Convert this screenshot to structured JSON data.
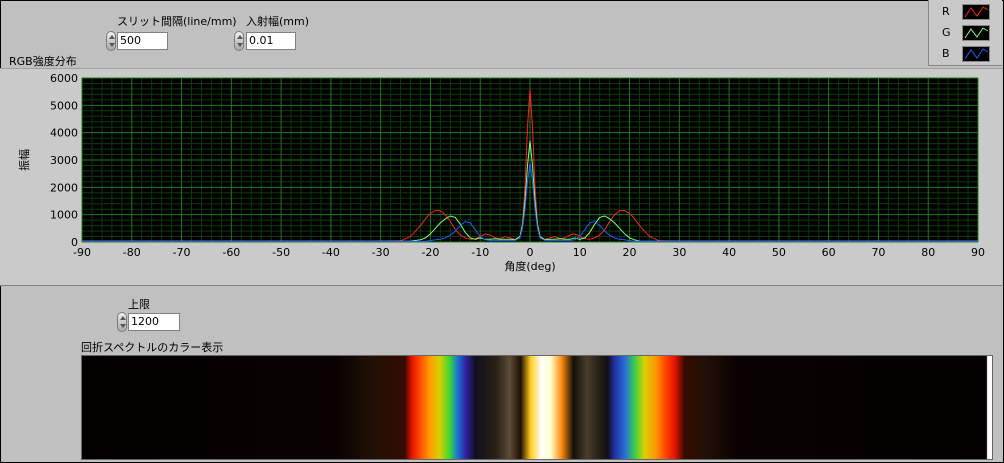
{
  "controls": {
    "slit": {
      "label": "スリット間隔(line/mm)",
      "value": "500"
    },
    "incident": {
      "label": "入射幅(mm)",
      "value": "0.01"
    },
    "upper": {
      "label": "上限",
      "value": "1200"
    }
  },
  "graph": {
    "title": "RGB強度分布"
  },
  "legend": [
    {
      "name": "R",
      "color": "#ff2020"
    },
    {
      "name": "G",
      "color": "#80ff80"
    },
    {
      "name": "B",
      "color": "#2060ff"
    }
  ],
  "spectrum": {
    "title": "回折スペクトルのカラー表示"
  },
  "chart_data": {
    "type": "line",
    "xlabel": "角度(deg)",
    "ylabel": "振幅",
    "xlim": [
      -90,
      90
    ],
    "ylim": [
      0,
      6000
    ],
    "xticks": [
      "-90",
      "-80",
      "-70",
      "-60",
      "-50",
      "-40",
      "-30",
      "-20",
      "-10",
      "0",
      "10",
      "20",
      "30",
      "40",
      "50",
      "60",
      "70",
      "80",
      "90"
    ],
    "yticks": [
      "0",
      "1000",
      "2000",
      "3000",
      "4000",
      "5000",
      "6000"
    ],
    "grid": true,
    "legend_position": "top-right",
    "x": [
      -90,
      -70,
      -50,
      -30,
      -26,
      -24,
      -22,
      -21,
      -20,
      -19,
      -18,
      -17,
      -16,
      -15,
      -14,
      -13,
      -12,
      -11,
      -10,
      -9,
      -8,
      -7,
      -6,
      -5,
      -4,
      -3,
      -2,
      -1.5,
      -1,
      -0.5,
      0,
      0.5,
      1,
      1.5,
      2,
      3,
      4,
      5,
      6,
      7,
      8,
      9,
      10,
      11,
      12,
      13,
      14,
      15,
      16,
      17,
      18,
      19,
      20,
      21,
      22,
      24,
      26,
      30,
      50,
      70,
      90
    ],
    "series": [
      {
        "name": "R",
        "color": "#ff2020",
        "values": [
          30,
          30,
          30,
          30,
          40,
          200,
          600,
          850,
          1050,
          1150,
          1150,
          1000,
          750,
          450,
          250,
          150,
          100,
          120,
          200,
          300,
          250,
          150,
          120,
          200,
          150,
          100,
          200,
          700,
          2000,
          4200,
          5600,
          4200,
          2000,
          700,
          200,
          100,
          150,
          200,
          120,
          150,
          250,
          300,
          200,
          120,
          100,
          150,
          250,
          450,
          750,
          1000,
          1150,
          1150,
          1050,
          850,
          600,
          200,
          40,
          30,
          30,
          30,
          30
        ]
      },
      {
        "name": "G",
        "color": "#80ff80",
        "values": [
          30,
          30,
          30,
          30,
          30,
          30,
          80,
          150,
          300,
          500,
          700,
          850,
          950,
          900,
          650,
          350,
          150,
          100,
          150,
          100,
          100,
          120,
          100,
          100,
          100,
          80,
          200,
          600,
          1500,
          2800,
          3700,
          2800,
          1500,
          600,
          200,
          80,
          100,
          100,
          120,
          100,
          100,
          150,
          100,
          150,
          350,
          650,
          900,
          950,
          850,
          700,
          500,
          300,
          150,
          80,
          30,
          30,
          30,
          30,
          30,
          30,
          30
        ]
      },
      {
        "name": "B",
        "color": "#2060ff",
        "values": [
          20,
          20,
          20,
          20,
          20,
          20,
          20,
          30,
          50,
          80,
          100,
          150,
          250,
          400,
          600,
          750,
          700,
          450,
          200,
          80,
          60,
          60,
          60,
          60,
          60,
          60,
          150,
          500,
          1200,
          2200,
          2900,
          2200,
          1200,
          500,
          150,
          60,
          60,
          60,
          60,
          60,
          60,
          80,
          200,
          450,
          700,
          750,
          600,
          400,
          250,
          150,
          100,
          80,
          50,
          30,
          20,
          20,
          20,
          20,
          20,
          20,
          20
        ]
      }
    ]
  }
}
